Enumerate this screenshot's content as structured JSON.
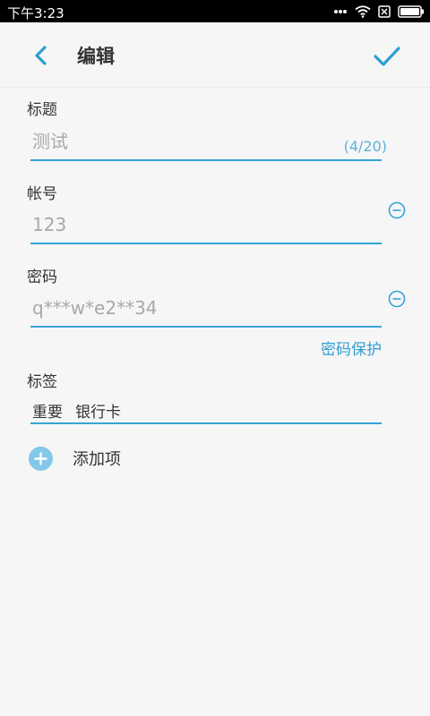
{
  "status_bar": {
    "time": "下午3:23",
    "icons": [
      "more-dots-icon",
      "wifi-icon",
      "no-sim-icon",
      "battery-icon"
    ]
  },
  "app_bar": {
    "title": "编辑",
    "back_icon": "chevron-left-icon",
    "confirm_icon": "check-icon"
  },
  "form": {
    "title_field": {
      "label": "标题",
      "placeholder": "测试",
      "counter": "(4/20)"
    },
    "account_field": {
      "label": "帐号",
      "placeholder": "123"
    },
    "password_field": {
      "label": "密码",
      "placeholder": "q***w*e2**34",
      "protect_link": "密码保护"
    },
    "tags_field": {
      "label": "标签",
      "tags": [
        "重要",
        "银行卡"
      ]
    },
    "add_item_label": "添加项"
  },
  "colors": {
    "accent": "#35a4d7",
    "background": "#f6f6f6",
    "add_circle": "#82c8ea"
  }
}
